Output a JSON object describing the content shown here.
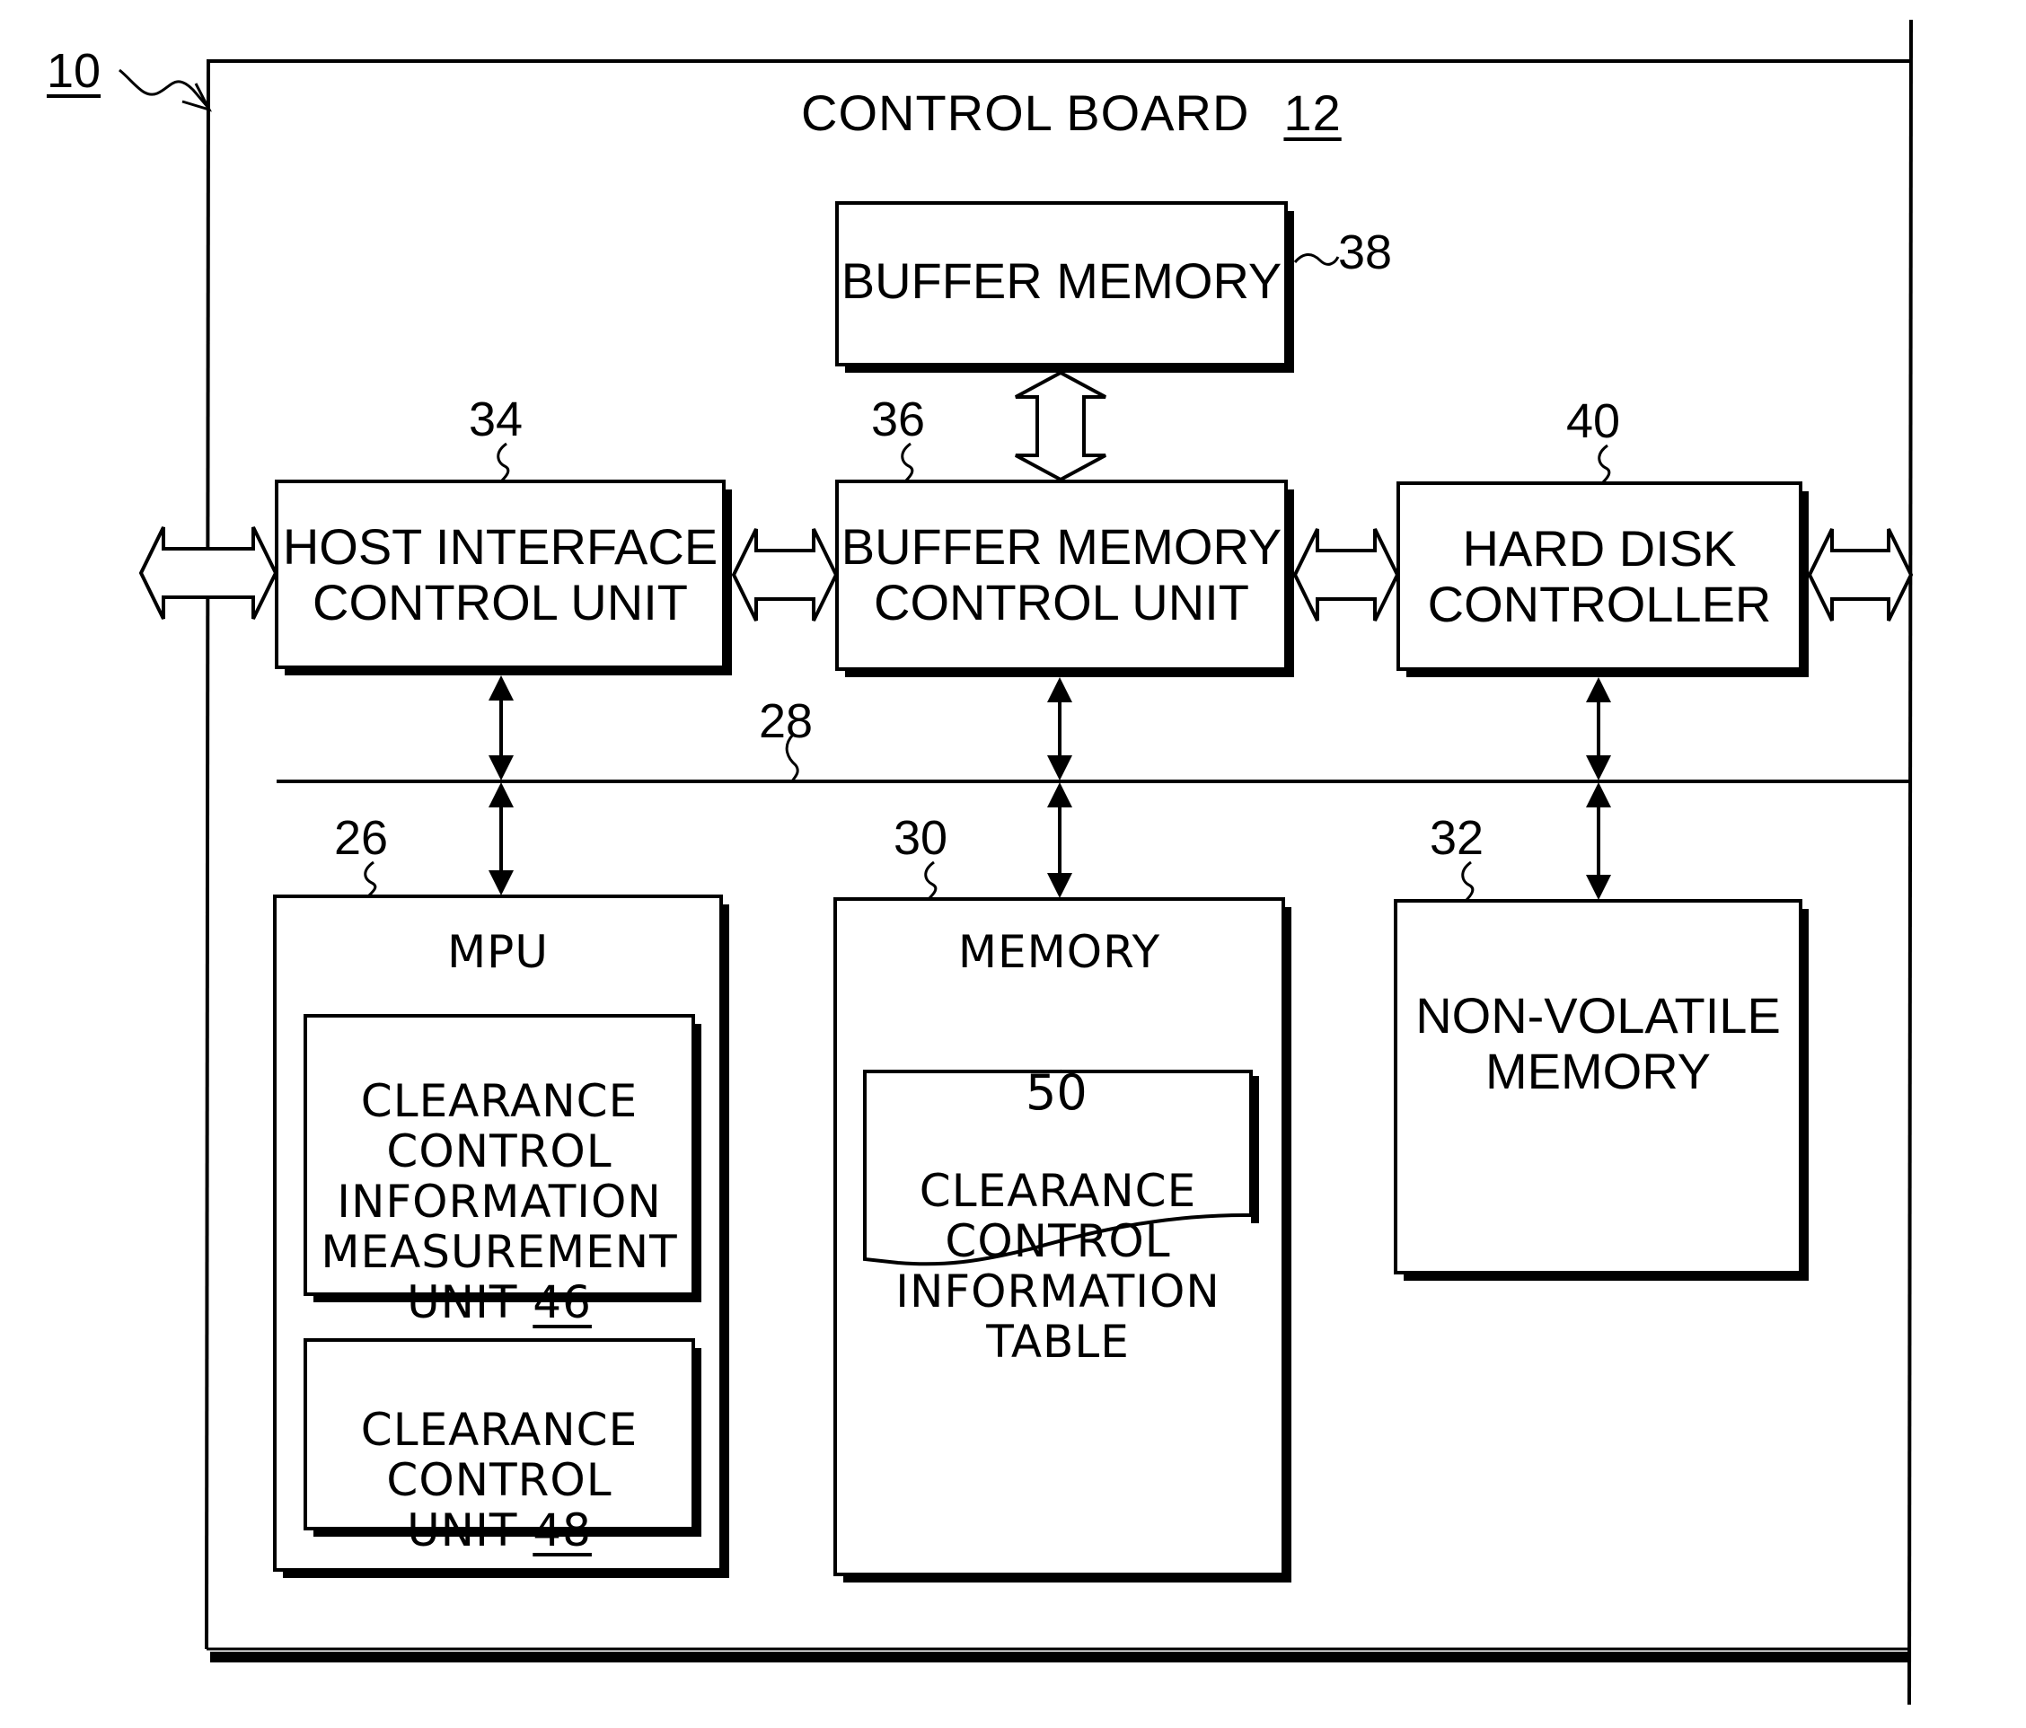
{
  "figure": {
    "device_ref": "10",
    "board": {
      "title": "CONTROL BOARD",
      "ref": "12"
    },
    "bus_ref": "28"
  },
  "blocks": {
    "buffer_memory": {
      "label": "BUFFER MEMORY",
      "ref": "38"
    },
    "host_interface": {
      "label": "HOST INTERFACE\nCONTROL UNIT",
      "ref": "34"
    },
    "buffer_memory_control": {
      "label": "BUFFER MEMORY\nCONTROL UNIT",
      "ref": "36"
    },
    "hard_disk_controller": {
      "label": "HARD DISK\nCONTROLLER",
      "ref": "40"
    },
    "mpu": {
      "label": "MPU",
      "ref": "26",
      "children": [
        {
          "label": "CLEARANCE\nCONTROL\nINFORMATION\nMEASUREMENT\nUNIT",
          "ref": "46"
        },
        {
          "label": "CLEARANCE\nCONTROL\nUNIT",
          "ref": "48"
        }
      ]
    },
    "memory": {
      "label": "MEMORY",
      "ref": "30",
      "table": {
        "label": "CLEARANCE\nCONTROL\nINFORMATION\nTABLE",
        "ref": "50"
      }
    },
    "non_volatile_memory": {
      "label": "NON-VOLATILE\nMEMORY",
      "ref": "32"
    }
  },
  "connections": [
    {
      "from": "external-host",
      "to": "host_interface",
      "type": "bidirectional-wide"
    },
    {
      "from": "host_interface",
      "to": "buffer_memory_control",
      "type": "bidirectional-wide"
    },
    {
      "from": "buffer_memory_control",
      "to": "hard_disk_controller",
      "type": "bidirectional-wide"
    },
    {
      "from": "hard_disk_controller",
      "to": "external-disk",
      "type": "bidirectional-wide"
    },
    {
      "from": "buffer_memory",
      "to": "buffer_memory_control",
      "type": "bidirectional-wide"
    },
    {
      "from": "host_interface",
      "to": "bus",
      "type": "bidirectional"
    },
    {
      "from": "buffer_memory_control",
      "to": "bus",
      "type": "bidirectional"
    },
    {
      "from": "hard_disk_controller",
      "to": "bus",
      "type": "bidirectional"
    },
    {
      "from": "bus",
      "to": "mpu",
      "type": "bidirectional"
    },
    {
      "from": "bus",
      "to": "memory",
      "type": "bidirectional"
    },
    {
      "from": "bus",
      "to": "non_volatile_memory",
      "type": "bidirectional"
    }
  ]
}
